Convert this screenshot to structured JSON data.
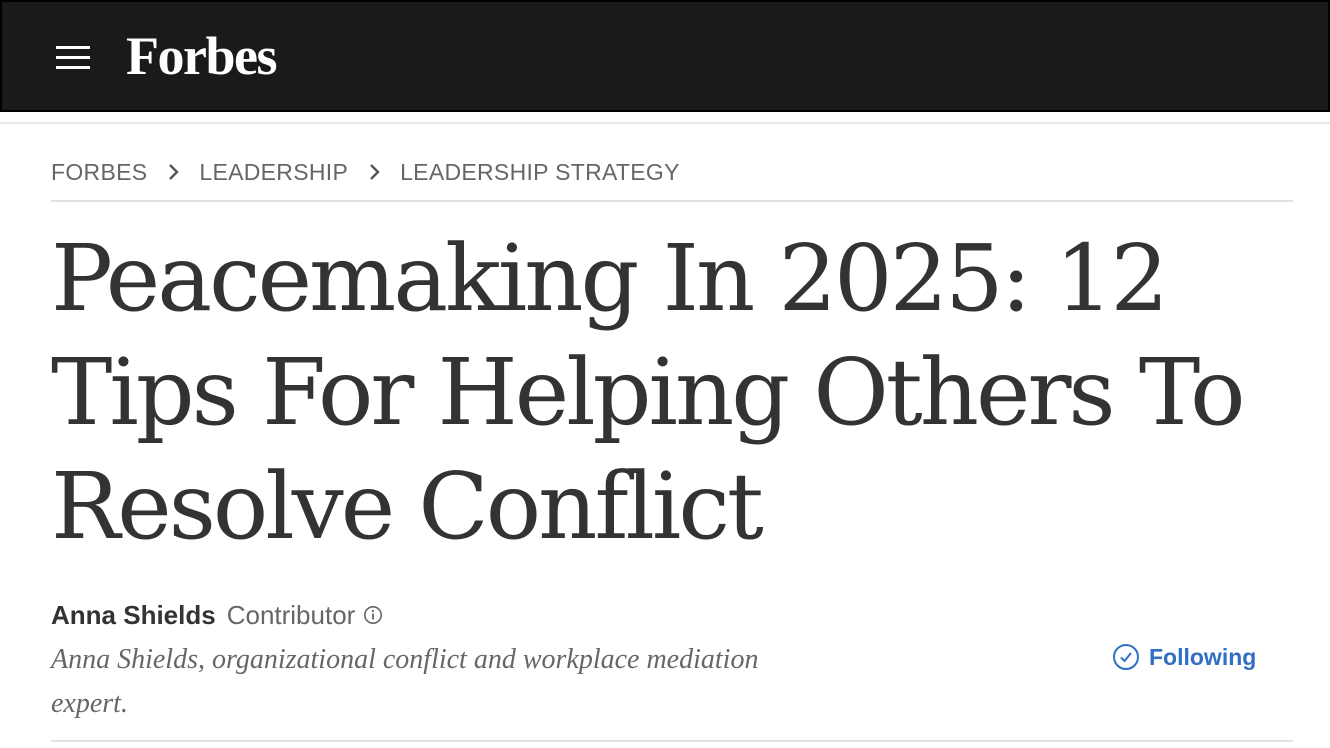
{
  "header": {
    "logo": "Forbes",
    "menu_icon": "hamburger-menu-icon",
    "background": "#1a1a1a"
  },
  "breadcrumb": {
    "items": [
      "FORBES",
      "LEADERSHIP",
      "LEADERSHIP STRATEGY"
    ],
    "separator_icon": "chevron-right-icon"
  },
  "article": {
    "title": "Peacemaking In 2025: 12 Tips For Helping Others To Resolve Conflict"
  },
  "author": {
    "name": "Anna Shields",
    "role": "Contributor",
    "info_icon": "info-icon",
    "bio": "Anna Shields, organizational conflict and workplace mediation expert."
  },
  "follow": {
    "label": "Following",
    "icon": "check-circle-icon",
    "color": "#2f6fc4"
  }
}
